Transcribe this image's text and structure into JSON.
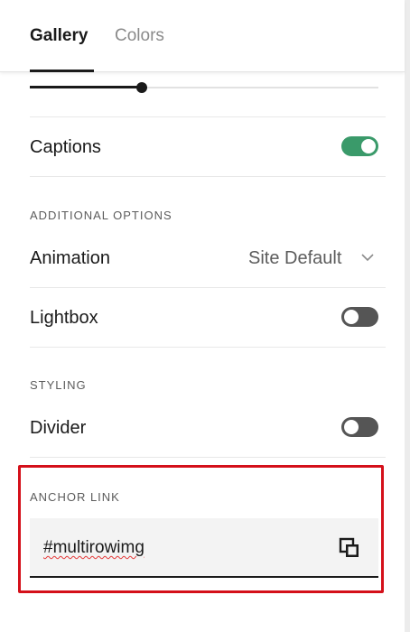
{
  "tabs": [
    {
      "label": "Gallery",
      "active": true
    },
    {
      "label": "Colors",
      "active": false
    }
  ],
  "slider": {
    "value": 0.32
  },
  "captions": {
    "label": "Captions",
    "enabled": true
  },
  "additional_options": {
    "heading": "ADDITIONAL OPTIONS",
    "animation": {
      "label": "Animation",
      "value": "Site Default"
    },
    "lightbox": {
      "label": "Lightbox",
      "enabled": false
    }
  },
  "styling": {
    "heading": "STYLING",
    "divider": {
      "label": "Divider",
      "enabled": false
    }
  },
  "anchor_link": {
    "heading": "ANCHOR LINK",
    "value": "#multirowimg"
  },
  "colors": {
    "toggle_on": "#3a9a6a",
    "toggle_off": "#555555",
    "highlight": "#d4101a"
  },
  "icons": [
    "chevron-down-icon",
    "copy-icon"
  ]
}
